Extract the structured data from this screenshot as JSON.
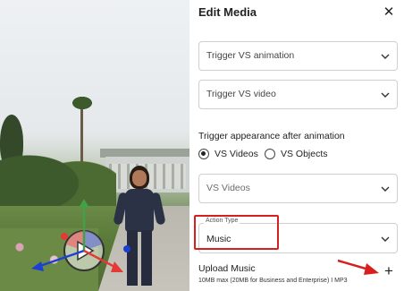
{
  "panel": {
    "title": "Edit Media",
    "close_icon": "close-icon"
  },
  "selects": {
    "trigger_animation": "Trigger VS animation",
    "trigger_video": "Trigger VS video",
    "vs_target": "VS Videos"
  },
  "trigger_appearance": {
    "label": "Trigger appearance after animation",
    "options": [
      "VS Videos",
      "VS Objects"
    ],
    "selected": "VS Videos"
  },
  "action_type": {
    "legend": "Action Type",
    "value": "Music"
  },
  "upload": {
    "title": "Upload Music",
    "hint": "10MB max (20MB for Business and Enterprise) I MP3",
    "add_icon": "plus-icon"
  },
  "colors": {
    "highlight": "#d62020",
    "gizmo_x": "#e53935",
    "gizmo_y": "#43a047",
    "gizmo_z": "#1e40d0"
  }
}
